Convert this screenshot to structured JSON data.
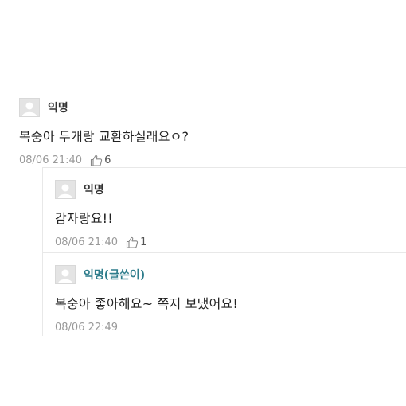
{
  "comments": [
    {
      "author": "익명",
      "text": "복숭아 두개랑 교환하실래요ㅇ?",
      "date": "08/06 21:40",
      "likes": "6",
      "avatar_icon": "default-profile-icon"
    }
  ],
  "replies": [
    {
      "author": "익명",
      "text": "감자랑요!!",
      "date": "08/06 21:40",
      "likes": "1",
      "avatar_icon": "default-profile-icon"
    },
    {
      "author": "익명(글쓴이)",
      "text": "복숭아 좋아해요~ 쪽지 보냈어요!",
      "date": "08/06 22:49",
      "avatar_icon": "default-profile-icon",
      "author_color": "#2e7d8c"
    }
  ],
  "colors": {
    "meta_text": "#999999",
    "border": "#e8e8e8",
    "writer_accent": "#2e7d8c"
  }
}
